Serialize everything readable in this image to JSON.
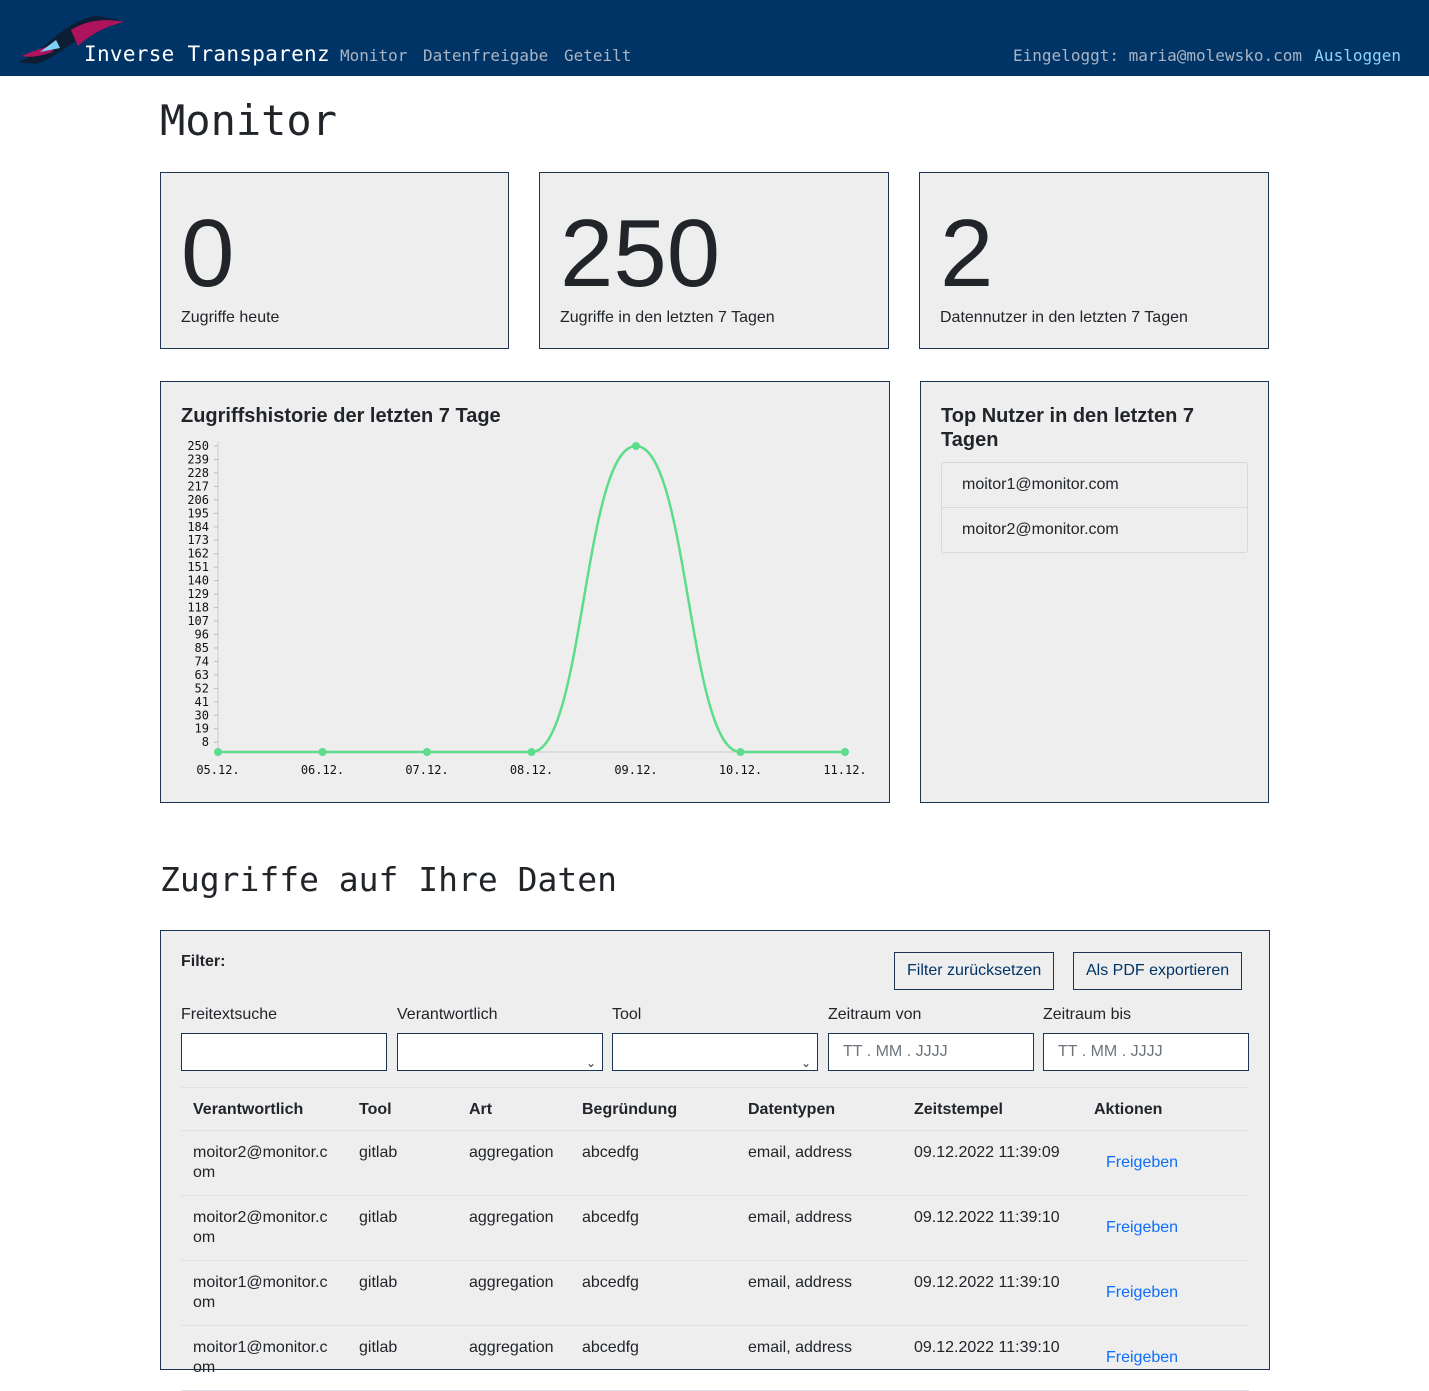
{
  "nav": {
    "brand": "Inverse Transparenz",
    "links": [
      "Monitor",
      "Datenfreigabe",
      "Geteilt"
    ],
    "user": "Eingeloggt: maria@molewsko.com",
    "logout": "Ausloggen"
  },
  "page_title": "Monitor",
  "stats": [
    {
      "value": "0",
      "label": "Zugriffe heute"
    },
    {
      "value": "250",
      "label": "Zugriffe in den letzten 7 Tagen"
    },
    {
      "value": "2",
      "label": "Datennutzer in den letzten 7 Tagen"
    }
  ],
  "top_users": {
    "title": "Top Nutzer in den letzten 7 Tagen",
    "items": [
      "moitor1@monitor.com",
      "moitor2@monitor.com"
    ]
  },
  "chart_data": {
    "type": "line",
    "title": "Zugriffshistorie der letzten 7 Tage",
    "categories": [
      "05.12.",
      "06.12.",
      "07.12.",
      "08.12.",
      "09.12.",
      "10.12.",
      "11.12."
    ],
    "values": [
      0,
      0,
      0,
      0,
      250,
      0,
      0
    ],
    "y_ticks": [
      "8",
      "19",
      "30",
      "41",
      "52",
      "63",
      "74",
      "85",
      "96",
      "107",
      "118",
      "129",
      "140",
      "151",
      "162",
      "173",
      "184",
      "195",
      "206",
      "217",
      "228",
      "239",
      "250"
    ],
    "ylim": [
      0,
      250
    ],
    "color": "#5ddc8a",
    "grid": false
  },
  "section_title": "Zugriffe auf Ihre Daten",
  "filter": {
    "label": "Filter:",
    "reset_button": "Filter zurücksetzen",
    "export_button": "Als PDF exportieren",
    "fields": {
      "freitext": {
        "label": "Freitextsuche",
        "value": ""
      },
      "verantwortlich": {
        "label": "Verantwortlich",
        "value": ""
      },
      "tool": {
        "label": "Tool",
        "value": ""
      },
      "von": {
        "label": "Zeitraum von",
        "placeholder": "TT . MM . JJJJ"
      },
      "bis": {
        "label": "Zeitraum bis",
        "placeholder": "TT . MM . JJJJ"
      }
    }
  },
  "table": {
    "headers": [
      "Verantwortlich",
      "Tool",
      "Art",
      "Begründung",
      "Datentypen",
      "Zeitstempel",
      "Aktionen"
    ],
    "rows": [
      {
        "verantwortlich": "moitor2@monitor.com",
        "tool": "gitlab",
        "art": "aggregation",
        "begruendung": "abcedfg",
        "datentypen": "email, address",
        "zeitstempel": "09.12.2022 11:39:09",
        "aktion": "Freigeben"
      },
      {
        "verantwortlich": "moitor2@monitor.com",
        "tool": "gitlab",
        "art": "aggregation",
        "begruendung": "abcedfg",
        "datentypen": "email, address",
        "zeitstempel": "09.12.2022 11:39:10",
        "aktion": "Freigeben"
      },
      {
        "verantwortlich": "moitor1@monitor.com",
        "tool": "gitlab",
        "art": "aggregation",
        "begruendung": "abcedfg",
        "datentypen": "email, address",
        "zeitstempel": "09.12.2022 11:39:10",
        "aktion": "Freigeben"
      },
      {
        "verantwortlich": "moitor1@monitor.com",
        "tool": "gitlab",
        "art": "aggregation",
        "begruendung": "abcedfg",
        "datentypen": "email, address",
        "zeitstempel": "09.12.2022 11:39:10",
        "aktion": "Freigeben"
      }
    ]
  }
}
